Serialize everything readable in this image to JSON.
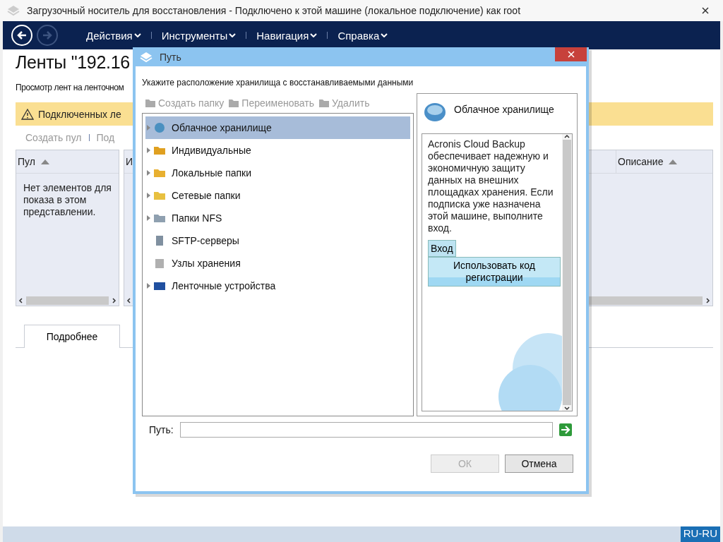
{
  "window": {
    "title": "Загрузочный носитель для восстановления - Подключено к этой машине (локальное подключение) как root"
  },
  "menu": [
    {
      "label": "Действия"
    },
    {
      "label": "Инструменты"
    },
    {
      "label": "Навигация"
    },
    {
      "label": "Справка"
    }
  ],
  "page": {
    "heading": "Ленты \"192.16",
    "subtitle": "Просмотр лент на ленточном",
    "warning": "Подключенных ле",
    "toolbar": [
      "Создать пул",
      "Под"
    ],
    "pools_table": {
      "columns": [
        {
          "label": "Пул",
          "sorted": true
        }
      ],
      "empty_text": "Нет элементов для показа в этом представлении."
    },
    "tapes_table": {
      "columns": [
        {
          "label": "И",
          "sorted": false
        },
        {
          "label": "Описание",
          "sorted": true
        }
      ]
    },
    "tabs": [
      {
        "label": "Подробнее",
        "selected": true
      }
    ]
  },
  "dialog": {
    "title": "Путь",
    "instruction": "Укажите расположение хранилища с восстанавливаемыми данными",
    "toolbar": [
      {
        "label": "Создать папку",
        "disabled": true
      },
      {
        "label": "Переименовать",
        "disabled": true
      },
      {
        "label": "Удалить",
        "disabled": true
      }
    ],
    "tree": [
      {
        "label": "Облачное хранилище",
        "expandable": true,
        "selected": true
      },
      {
        "label": "Индивидуальные",
        "expandable": true,
        "selected": false
      },
      {
        "label": "Локальные папки",
        "expandable": true,
        "selected": false
      },
      {
        "label": "Сетевые папки",
        "expandable": true,
        "selected": false
      },
      {
        "label": "Папки NFS",
        "expandable": true,
        "selected": false
      },
      {
        "label": "SFTP-серверы",
        "expandable": false,
        "selected": false
      },
      {
        "label": "Узлы хранения",
        "expandable": false,
        "selected": false
      },
      {
        "label": "Ленточные устройства",
        "expandable": true,
        "selected": false
      }
    ],
    "info": {
      "title": "Облачное хранилище",
      "text": "Acronis Cloud Backup обеспечивает надежную и экономичную защиту данных на внешних площадках хранения. Если подписка уже назначена этой машине, выполните вход.",
      "login_button": "Вход",
      "register_button": "Использовать код регистрации"
    },
    "path_label": "Путь:",
    "buttons": [
      {
        "label": "ОК",
        "disabled": true
      },
      {
        "label": "Отмена",
        "disabled": false
      }
    ]
  },
  "status_bar": {
    "locale": "RU-RU"
  }
}
